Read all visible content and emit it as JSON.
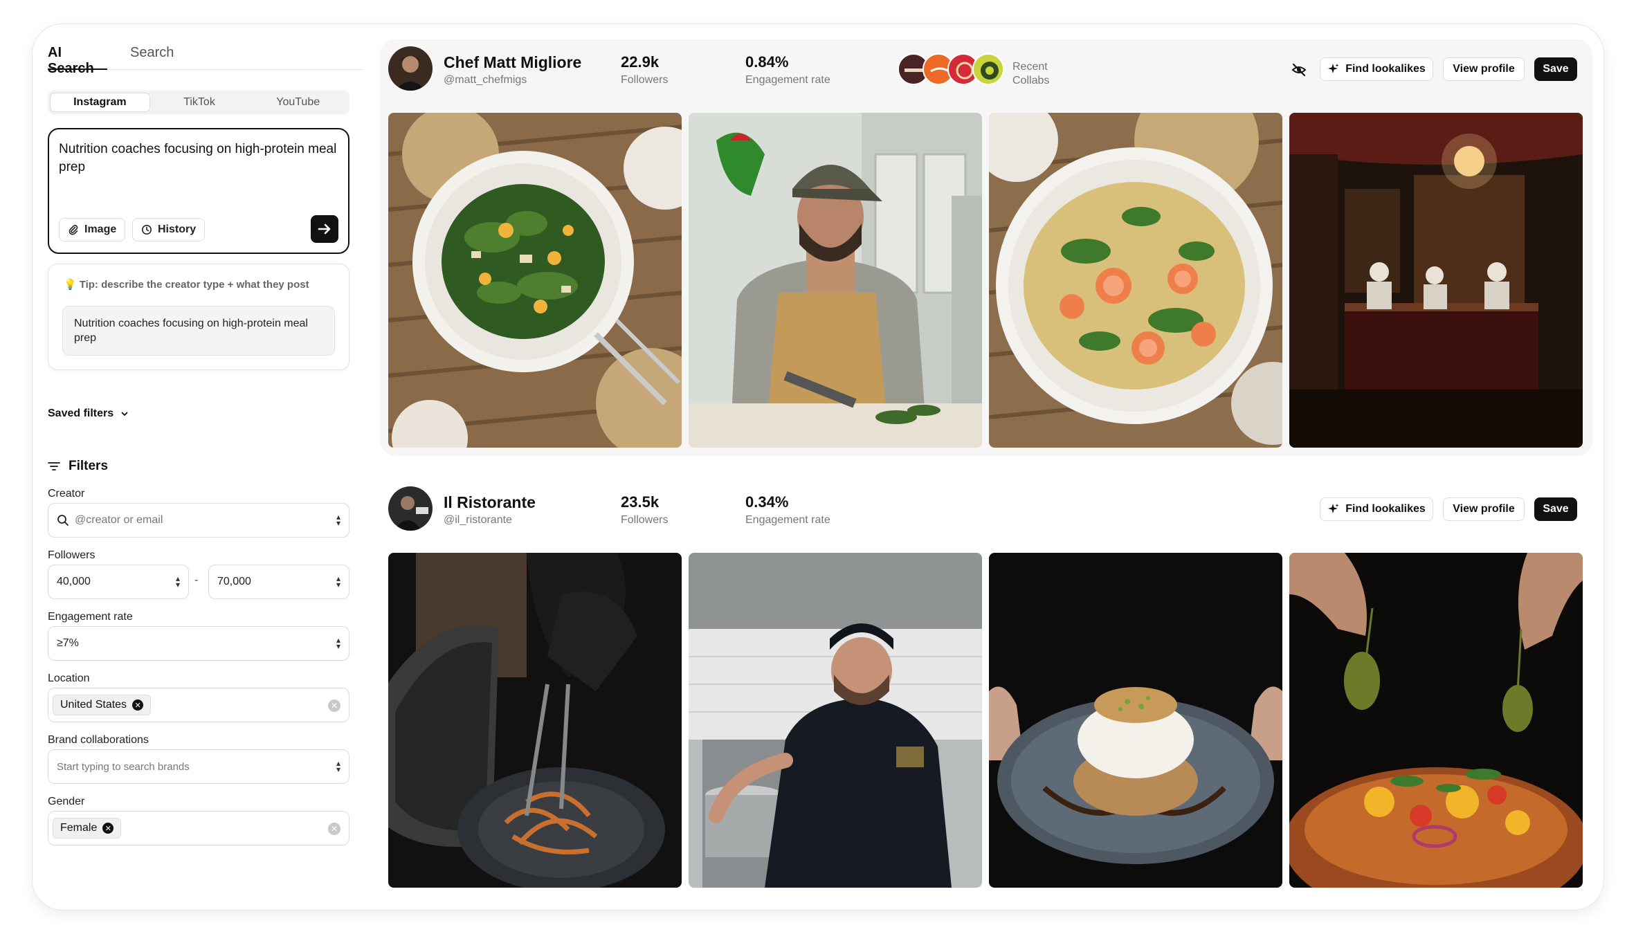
{
  "sidebar": {
    "search_tabs": [
      "AI Search",
      "Search"
    ],
    "platform_tabs": [
      "Instagram",
      "TikTok",
      "YouTube"
    ],
    "prompt": {
      "text": "Nutrition coaches focusing on high-protein meal prep",
      "image_label": "Image",
      "history_label": "History"
    },
    "tip": {
      "text": "Tip: describe the creator type + what they post",
      "suggestion": "Nutrition coaches focusing on high-protein meal prep"
    },
    "saved_filters_label": "Saved filters",
    "filters": {
      "heading": "Filters",
      "creator": {
        "label": "Creator",
        "placeholder": "@creator or email"
      },
      "followers": {
        "label": "Followers",
        "min": "40,000",
        "separator": "-",
        "max": "70,000"
      },
      "engagement": {
        "label": "Engagement rate",
        "value": "≥7%"
      },
      "location": {
        "label": "Location",
        "tag": "United States"
      },
      "brands": {
        "label": "Brand collaborations",
        "placeholder": "Start typing to search brands"
      },
      "gender": {
        "label": "Gender",
        "tag": "Female"
      }
    }
  },
  "creators": [
    {
      "name": "Chef Matt Migliore",
      "handle": "@matt_chefmigs",
      "followers_value": "22.9k",
      "followers_label": "Followers",
      "engagement_value": "0.84%",
      "engagement_label": "Engagement rate",
      "collabs_label_1": "Recent",
      "collabs_label_2": "Collabs",
      "find_label": "Find lookalikes",
      "view_label": "View profile",
      "save_label": "Save"
    },
    {
      "name": "Il Ristorante",
      "handle": "@il_ristorante",
      "followers_value": "23.5k",
      "followers_label": "Followers",
      "engagement_value": "0.34%",
      "engagement_label": "Engagement rate",
      "find_label": "Find lookalikes",
      "view_label": "View profile",
      "save_label": "Save"
    }
  ],
  "icons": {
    "send": "arrow-right-icon",
    "image": "paperclip-icon",
    "history": "clock-icon",
    "filters": "filter-lines-icon",
    "hide": "eye-off-icon",
    "lookalikes": "sparkle-icon"
  },
  "colors": {
    "accent": "#111111",
    "card_bg": "#f6f6f6"
  }
}
